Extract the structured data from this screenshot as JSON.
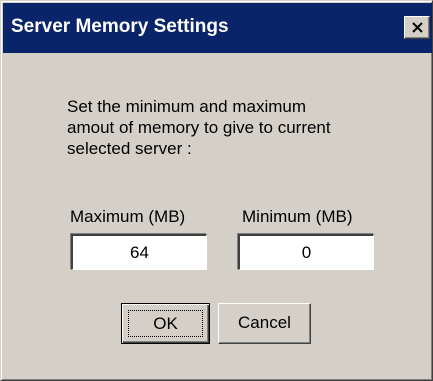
{
  "window": {
    "title": "Server Memory Settings"
  },
  "description": {
    "line1": "Set the minimum and maximum",
    "line2": "amout of memory to give to current",
    "line3": "selected server :"
  },
  "fields": {
    "maximum_label": "Maximum (MB)",
    "maximum_value": "64",
    "minimum_label": "Minimum (MB)",
    "minimum_value": "0"
  },
  "buttons": {
    "ok_label": "OK",
    "cancel_label": "Cancel"
  },
  "icons": {
    "close": "close-icon"
  },
  "colors": {
    "titlebar": "#0a246a",
    "dialog_face": "#d4d0c8"
  }
}
